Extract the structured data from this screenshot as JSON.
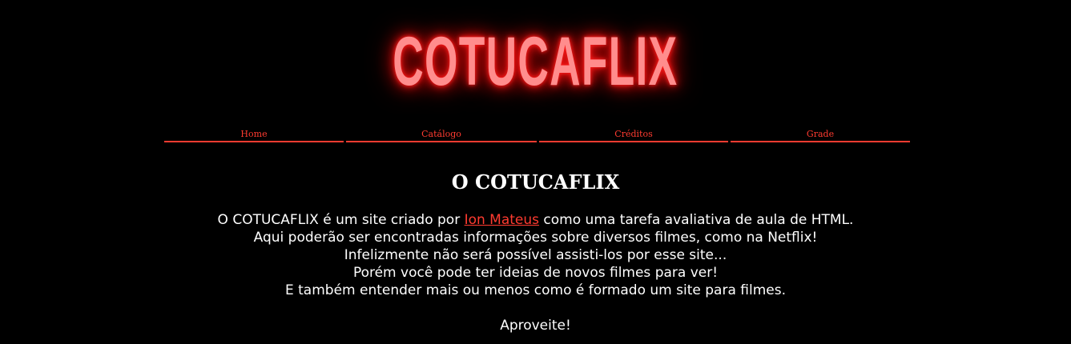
{
  "header": {
    "logo_text": "COTUCAFLIX"
  },
  "nav": {
    "items": [
      {
        "label": "Home"
      },
      {
        "label": "Catálogo"
      },
      {
        "label": "Créditos"
      },
      {
        "label": "Grade"
      }
    ]
  },
  "main": {
    "title": "O COTUCAFLIX",
    "intro_before_link": "O COTUCAFLIX é um site criado por ",
    "author_link": "Ion Mateus",
    "intro_after_link": " como uma tarefa avaliativa de aula de HTML.",
    "line2": "Aqui poderão ser encontradas informações sobre diversos filmes, como na Netflix!",
    "line3": "Infelizmente não será possível assisti-los por esse site...",
    "line4": "Porém você pode ter ideias de novos filmes para ver!",
    "line5": "E também entender mais ou menos como é formado um site para filmes.",
    "closing": "Aproveite!"
  },
  "colors": {
    "background": "#000000",
    "accent": "#ff3b30",
    "logo_glow": "#ff1a1a",
    "logo_fill": "#ff8d8d",
    "text": "#ffffff"
  }
}
